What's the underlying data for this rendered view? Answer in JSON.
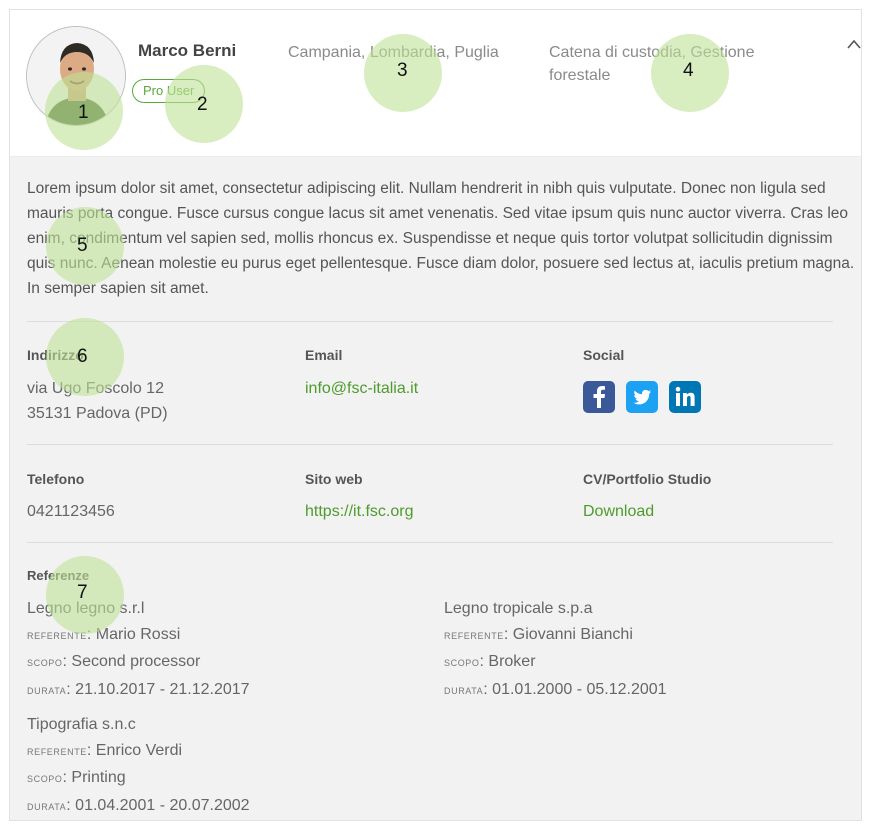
{
  "profile": {
    "name": "Marco Berni",
    "badge": "Pro User",
    "regions": "Campania, Lombardia, Puglia",
    "skills": "Catena di custodia, Gestione forestale"
  },
  "description": "Lorem ipsum dolor sit amet, consectetur adipiscing elit. Nullam hendrerit in nibh quis vulputate. Donec non ligula sed mauris porta congue. Fusce cursus congue lacus sit amet venenatis. Sed vitae ipsum quis nunc auctor viverra. Cras leo enim, condimentum vel sapien sed, mollis rhoncus ex. Suspendisse et neque quis tortor volutpat sollicitudin dignissim quis nunc. Aenean molestie eu purus eget pellentesque. Fusce diam dolor, posuere sed lectus at, iaculis pretium magna. In semper sapien sit amet.",
  "contacts": {
    "address_label": "Indirizzo",
    "address_line1": "via Ugo Foscolo 12",
    "address_line2": "35131 Padova (PD)",
    "email_label": "Email",
    "email": "info@fsc-italia.it",
    "social_label": "Social",
    "social": [
      "facebook-icon",
      "twitter-icon",
      "linkedin-icon"
    ],
    "phone_label": "Telefono",
    "phone": "0421123456",
    "website_label": "Sito web",
    "website": "https://it.fsc.org",
    "cv_label": "CV/Portfolio Studio",
    "cv_link": "Download"
  },
  "references": {
    "label": "Referenze",
    "referente_label": "referente",
    "scopo_label": "scopo",
    "durata_label": "durata",
    "items": [
      {
        "company": "Legno legno s.r.l",
        "referente": "Mario Rossi",
        "scopo": "Second processor",
        "durata": "21.10.2017 - 21.12.2017"
      },
      {
        "company": "Legno tropicale s.p.a",
        "referente": "Giovanni Bianchi",
        "scopo": "Broker",
        "durata": "01.01.2000 - 05.12.2001"
      },
      {
        "company": "Tipografia s.n.c",
        "referente": "Enrico Verdi",
        "scopo": "Printing",
        "durata": "01.04.2001 - 20.07.2002"
      }
    ]
  },
  "markers": [
    "1",
    "2",
    "3",
    "4",
    "5",
    "6",
    "7"
  ],
  "colors": {
    "accent": "#4e9b2e",
    "facebook": "#3b5998",
    "twitter": "#1da1f2",
    "linkedin": "#0077b5"
  }
}
